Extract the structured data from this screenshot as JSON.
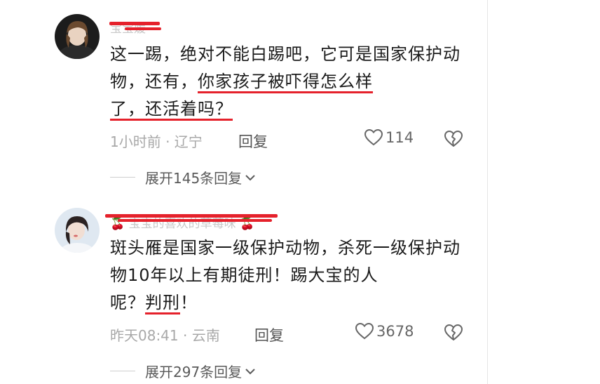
{
  "comments": [
    {
      "username": "宝宝媛",
      "text_parts": [
        "这一踢，绝对不能白踢吧，它可是国家保护动物，还有，",
        "你家孩子被吓得怎么样",
        "了，还活着吗？"
      ],
      "meta": "1小时前 · 辽宁",
      "reply_label": "回复",
      "likes": "114",
      "expand_label": "展开145条回复"
    },
    {
      "username": "🍒 宝宝的喜欢的草莓味 🍒",
      "text_parts": [
        "斑头雁是国家一级保护动物，杀死一级保护动物10年以上有期徒刑！踢大宝的人",
        "呢？",
        "判刑",
        "！"
      ],
      "meta": "昨天08:41 · 云南",
      "reply_label": "回复",
      "likes": "3678",
      "expand_label": "展开297条回复"
    }
  ],
  "colors": {
    "underline": "#e5212b",
    "meta": "#a8a8a8"
  },
  "icons": [
    "heart-icon",
    "broken-heart-icon",
    "chevron-down-icon"
  ]
}
